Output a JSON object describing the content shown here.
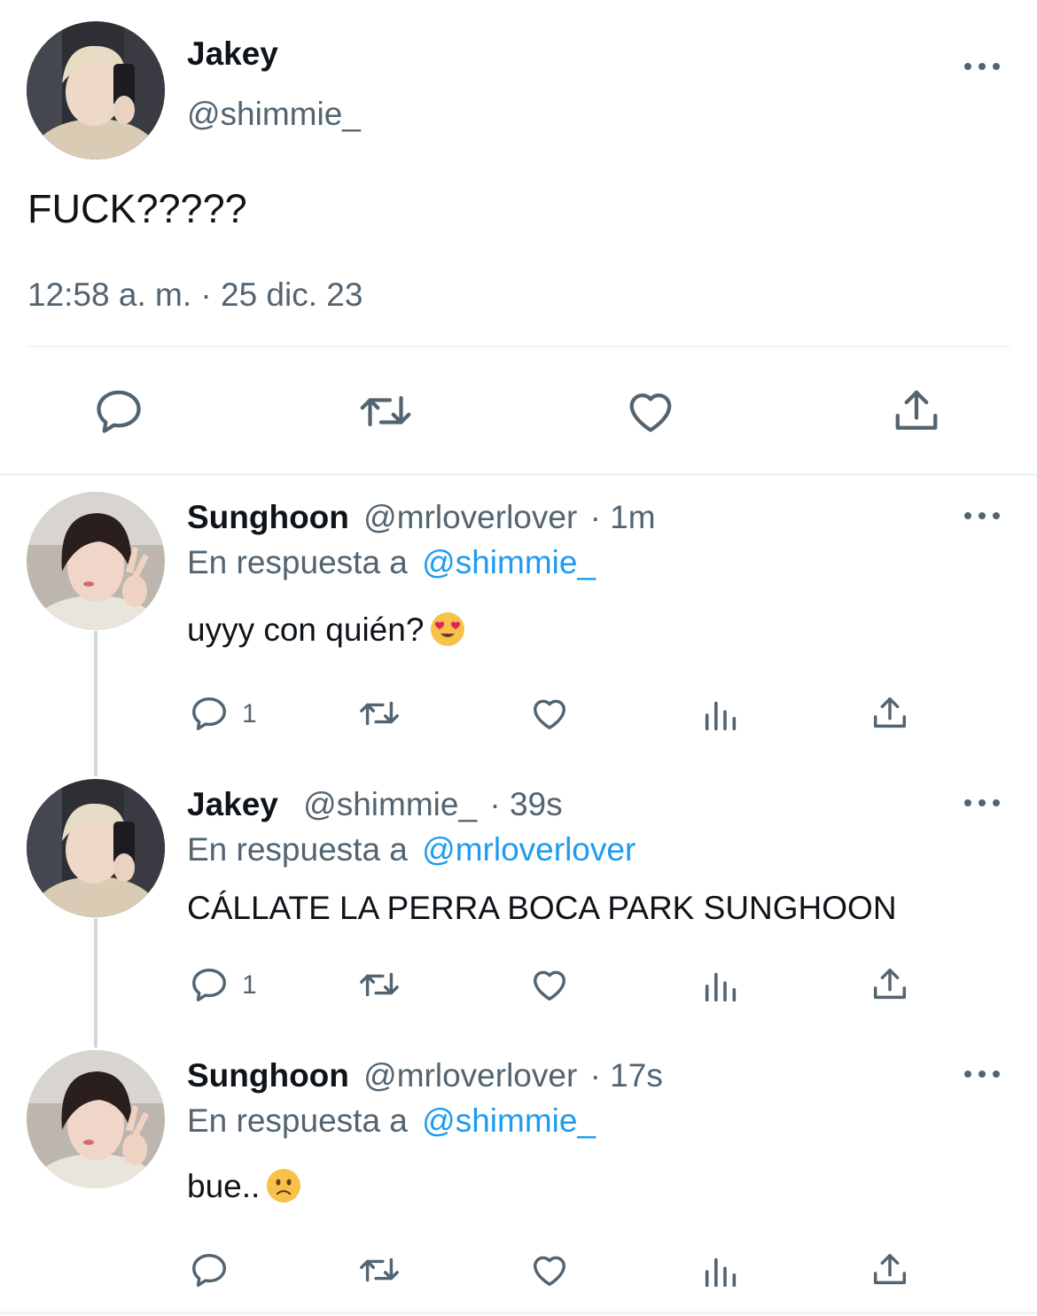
{
  "main_tweet": {
    "author_name": "Jakey",
    "handle": "@shimmie_",
    "text": "FUCK?????",
    "timestamp": "12:58 a. m. · 25 dic. 23",
    "actions": [
      "reply-icon",
      "retweet-icon",
      "like-icon",
      "share-icon"
    ]
  },
  "replies": [
    {
      "author_name": "Sunghoon",
      "handle": "@mrloverlover",
      "time": "· 1m",
      "reply_prefix": "En respuesta a",
      "reply_to": "@shimmie_",
      "text": "uyyy con quién?",
      "emoji": "heart-eyes-emoji",
      "reply_count": "1"
    },
    {
      "author_name": "Jakey",
      "handle": "@shimmie_",
      "time": "· 39s",
      "reply_prefix": "En respuesta a",
      "reply_to": "@mrloverlover",
      "text": "CÁLLATE LA PERRA BOCA PARK SUNGHOON",
      "reply_count": "1"
    },
    {
      "author_name": "Sunghoon",
      "handle": "@mrloverlover",
      "time": "· 17s",
      "reply_prefix": "En respuesta a",
      "reply_to": "@shimmie_",
      "text": "bue..",
      "emoji": "slightly-frowning-emoji",
      "reply_count": ""
    }
  ],
  "colors": {
    "text": "#0f1419",
    "secondary": "#536471",
    "link": "#1d9bf0",
    "divider": "#eff3f4"
  }
}
